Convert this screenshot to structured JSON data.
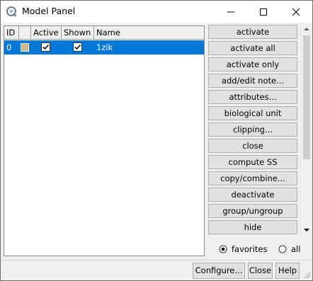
{
  "window": {
    "title": "Model Panel",
    "icon": "chimera-app-icon"
  },
  "table": {
    "headers": {
      "id": "ID",
      "color": "",
      "active": "Active",
      "shown": "Shown",
      "name": "Name"
    },
    "rows": [
      {
        "id": "0",
        "color": "#d2b48c",
        "active": true,
        "shown": true,
        "name": "1zik",
        "selected": true
      }
    ]
  },
  "commands": [
    "activate",
    "activate all",
    "activate only",
    "add/edit note...",
    "attributes...",
    "biological unit",
    "clipping...",
    "close",
    "compute SS",
    "copy/combine...",
    "deactivate",
    "group/ungroup",
    "hide"
  ],
  "filter": {
    "options": [
      "favorites",
      "all"
    ],
    "selected": "favorites"
  },
  "buttons": {
    "configure": "Configure...",
    "close": "Close",
    "help": "Help"
  },
  "colors": {
    "selection": "#0078d7",
    "button_face": "#e1e1e1",
    "window_bg": "#f0f0f0"
  }
}
